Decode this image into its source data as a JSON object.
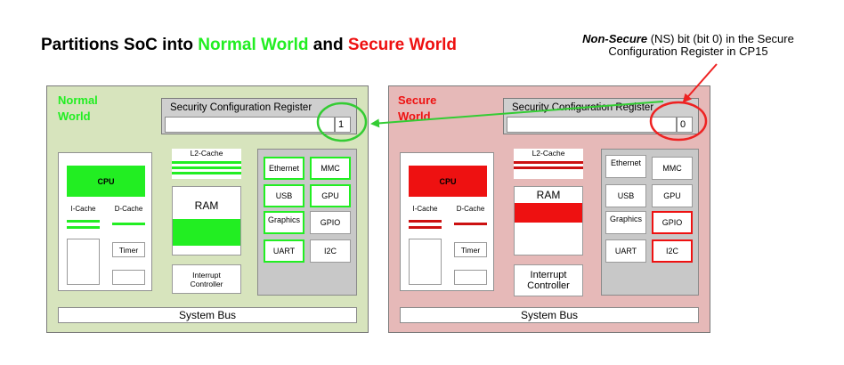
{
  "colors": {
    "normal_accent": "#22ee22",
    "secure_accent": "#ee1111",
    "normal_bg": "#d7e4bd",
    "secure_bg": "#e6b9b8",
    "arrow_green": "#33cc33",
    "arrow_red": "#ee2222"
  },
  "title": {
    "prefix": "Partitions SoC into ",
    "normal": "Normal World",
    "middle": " and ",
    "secure": "Secure World"
  },
  "ns_note": {
    "emph": "Non-Secure",
    "line1_rest": " (NS)  bit (bit 0) in the Secure",
    "line2": "Configuration Register  in CP15"
  },
  "normal_world": {
    "label_line1": "Normal",
    "label_line2": "World",
    "scr_title": "Security Configuration Register",
    "scr_value": "1",
    "cpu": "CPU",
    "icache": "I-Cache",
    "dcache": "D-Cache",
    "timer": "Timer",
    "l2cache": "L2-Cache",
    "ram": "RAM",
    "interrupt_line1": "Interrupt",
    "interrupt_line2": "Controller",
    "peripherals": [
      "Ethernet",
      "MMC",
      "USB",
      "GPU",
      "Graphics",
      "GPIO",
      "UART",
      "I2C"
    ],
    "peripherals_secure_flag": [
      false,
      false,
      false,
      false,
      false,
      false,
      false,
      false
    ],
    "peripherals_highlight": [
      true,
      true,
      true,
      true,
      true,
      false,
      true,
      false
    ],
    "system_bus": "System Bus"
  },
  "secure_world": {
    "label_line1": "Secure",
    "label_line2": "World",
    "scr_title": "Security Configuration Register",
    "scr_value": "0",
    "cpu": "CPU",
    "icache": "I-Cache",
    "dcache": "D-Cache",
    "timer": "Timer",
    "l2cache": "L2-Cache",
    "ram": "RAM",
    "interrupt_line1": "Interrupt",
    "interrupt_line2": "Controller",
    "peripherals": [
      "Ethernet",
      "MMC",
      "USB",
      "GPU",
      "Graphics",
      "GPIO",
      "UART",
      "I2C"
    ],
    "peripherals_highlight": [
      false,
      false,
      false,
      false,
      false,
      true,
      false,
      true
    ],
    "system_bus": "System Bus"
  }
}
